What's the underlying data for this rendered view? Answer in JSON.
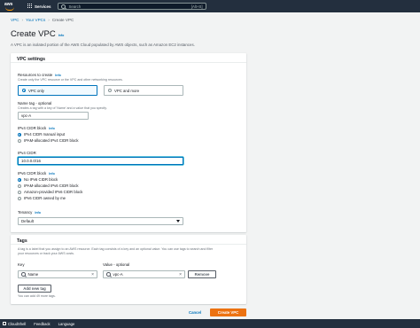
{
  "topbar": {
    "logo_text": "aws",
    "services_label": "Services",
    "search_placeholder": "Search",
    "search_shortcut": "[Alt+S]"
  },
  "breadcrumb": {
    "item1": "VPC",
    "item2": "Your VPCs",
    "current": "Create VPC"
  },
  "page": {
    "title": "Create VPC",
    "info": "Info",
    "description": "A VPC is an isolated portion of the AWS Cloud populated by AWS objects, such as Amazon EC2 instances."
  },
  "vpc_settings": {
    "heading": "VPC settings",
    "resources_label": "Resources to create",
    "resources_info": "Info",
    "resources_desc": "Create only the VPC resource or the VPC and other networking resources.",
    "option_vpc_only": "VPC only",
    "option_vpc_more": "VPC and more",
    "name_tag_label": "Name tag - optional",
    "name_tag_desc": "Creates a tag with a key of 'Name' and a value that you specify.",
    "name_tag_value": "vpc-A",
    "ipv4_block_label": "IPv4 CIDR block",
    "ipv4_block_info": "Info",
    "ipv4_manual": "IPv4 CIDR manual input",
    "ipv4_ipam": "IPAM-allocated IPv4 CIDR block",
    "ipv4_cidr_label": "IPv4 CIDR",
    "ipv4_cidr_value": "10.0.0.0/16",
    "ipv6_block_label": "IPv6 CIDR block",
    "ipv6_block_info": "Info",
    "ipv6_none": "No IPv6 CIDR block",
    "ipv6_ipam": "IPAM-allocated IPv6 CIDR block",
    "ipv6_amazon": "Amazon-provided IPv6 CIDR block",
    "ipv6_owned": "IPv6 CIDR owned by me",
    "tenancy_label": "Tenancy",
    "tenancy_info": "Info",
    "tenancy_value": "Default"
  },
  "tags": {
    "heading": "Tags",
    "desc_line1": "A tag is a label that you assign to an AWS resource. Each tag consists of a key and an optional value. You can use tags to search and filter",
    "desc_line2": "your resources or track your AWS costs.",
    "key_label": "Key",
    "value_label": "Value - optional",
    "key_value": "Name",
    "value_value": "vpc-A",
    "remove_label": "Remove",
    "add_label": "Add new tag",
    "limit_text": "You can add 49 more tags."
  },
  "actions": {
    "cancel": "Cancel",
    "create": "Create VPC"
  },
  "footer": {
    "cloudshell": "CloudShell",
    "feedback": "Feedback",
    "language": "Language"
  },
  "colors": {
    "primary": "#ec7211",
    "link": "#0073bb",
    "nav": "#232f3e"
  }
}
